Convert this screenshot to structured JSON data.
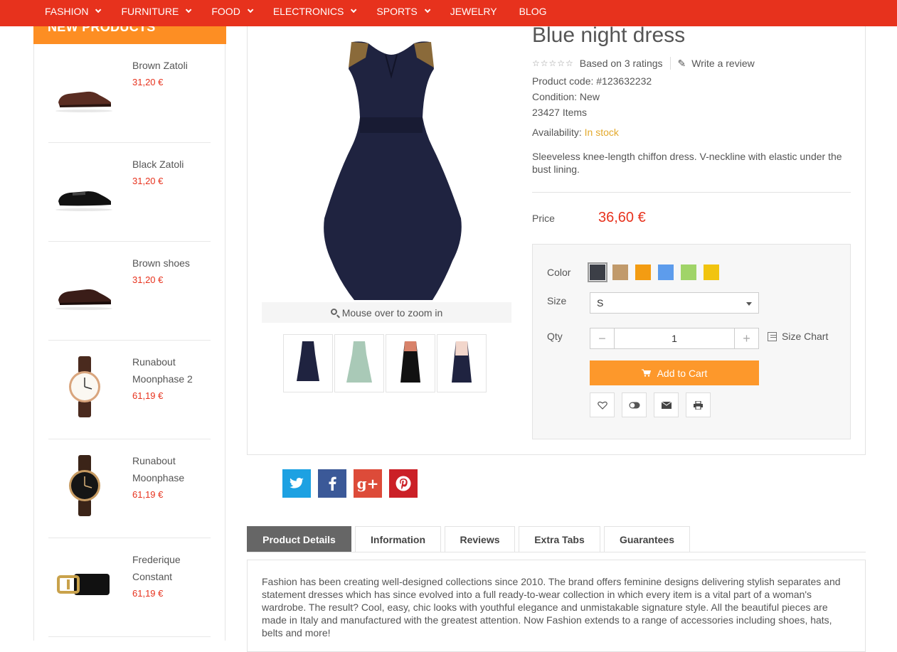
{
  "nav": {
    "items": [
      {
        "label": "FASHION",
        "dropdown": true
      },
      {
        "label": "FURNITURE",
        "dropdown": true
      },
      {
        "label": "FOOD",
        "dropdown": true
      },
      {
        "label": "ELECTRONICS",
        "dropdown": true
      },
      {
        "label": "SPORTS",
        "dropdown": true
      },
      {
        "label": "JEWELRY",
        "dropdown": false
      },
      {
        "label": "BLOG",
        "dropdown": false
      }
    ],
    "color": "#e7321d"
  },
  "sidebar": {
    "title": "NEW PRODUCTS",
    "products": [
      {
        "name": "Brown Zatoli",
        "price": "31,20 €",
        "icon": "shoe-brown"
      },
      {
        "name": "Black Zatoli",
        "price": "31,20 €",
        "icon": "shoe-black"
      },
      {
        "name": "Brown shoes",
        "price": "31,20 €",
        "icon": "shoe-brown-dark"
      },
      {
        "name": "Runabout Moonphase 2",
        "price": "61,19 €",
        "icon": "watch-white"
      },
      {
        "name": "Runabout Moonphase",
        "price": "61,19 €",
        "icon": "watch-black"
      },
      {
        "name": "Frederique Constant",
        "price": "61,19 €",
        "icon": "belt"
      }
    ]
  },
  "product": {
    "title": "Blue night dress",
    "rating_text": "Based on 3 ratings",
    "review_link": "Write a review",
    "code": "Product code: #123632232",
    "condition": "Condition: New",
    "items": "23427 Items",
    "availability_label": "Availability:",
    "availability_value": "In stock",
    "description": "Sleeveless knee-length chiffon dress. V-neckline with elastic under the bust lining.",
    "price_label": "Price",
    "price": "36,60 €",
    "zoom_hint": "Mouse over to zoom in"
  },
  "options": {
    "color_label": "Color",
    "colors": [
      "#3c3f47",
      "#c19a6b",
      "#f39c12",
      "#5d9cec",
      "#a0d468",
      "#f1c40f"
    ],
    "size_label": "Size",
    "size_value": "S",
    "qty_label": "Qty",
    "qty_value": "1",
    "size_chart": "Size Chart",
    "add_to_cart": "Add to Cart"
  },
  "social": [
    "twitter",
    "facebook",
    "google-plus",
    "pinterest"
  ],
  "tabs": {
    "items": [
      "Product Details",
      "Information",
      "Reviews",
      "Extra Tabs",
      "Guarantees"
    ],
    "active": 0,
    "content": "Fashion has been creating well-designed collections since 2010. The brand offers feminine designs delivering stylish separates and statement dresses which has since evolved into a full ready-to-wear collection in which every item is a vital part of a woman's wardrobe. The result? Cool, easy, chic looks with youthful elegance and unmistakable signature style. All the beautiful pieces are made in Italy and manufactured with the greatest attention. Now Fashion extends to a range of accessories including shoes, hats, belts and more!"
  }
}
